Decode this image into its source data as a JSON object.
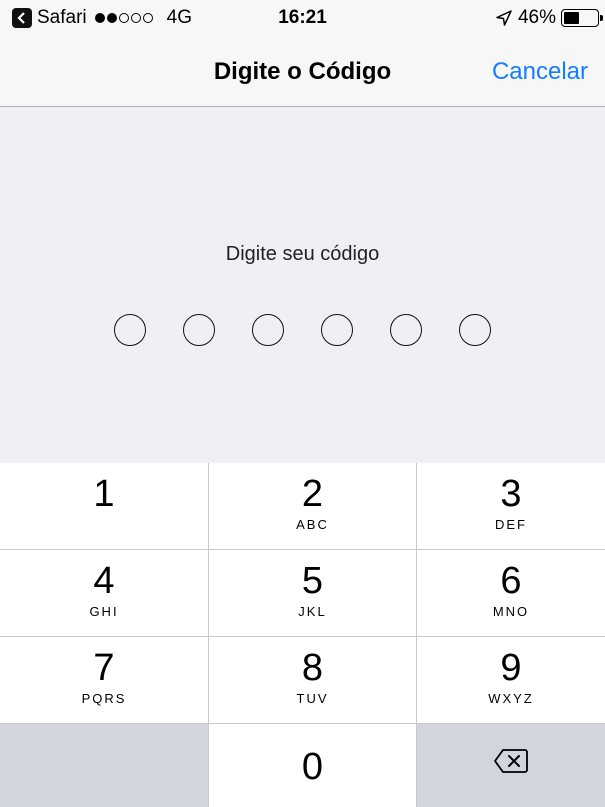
{
  "status_bar": {
    "app": "Safari",
    "carrier": "4G",
    "time": "16:21",
    "battery": "46%",
    "battery_level": 0.46,
    "signal_strength": 2,
    "signal_max": 5
  },
  "nav": {
    "title": "Digite o Código",
    "cancel_label": "Cancelar"
  },
  "passcode": {
    "prompt": "Digite seu código",
    "length": 6,
    "entered": 0
  },
  "keypad": {
    "keys": [
      {
        "num": "1",
        "letters": ""
      },
      {
        "num": "2",
        "letters": "ABC"
      },
      {
        "num": "3",
        "letters": "DEF"
      },
      {
        "num": "4",
        "letters": "GHI"
      },
      {
        "num": "5",
        "letters": "JKL"
      },
      {
        "num": "6",
        "letters": "MNO"
      },
      {
        "num": "7",
        "letters": "PQRS"
      },
      {
        "num": "8",
        "letters": "TUV"
      },
      {
        "num": "9",
        "letters": "WXYZ"
      },
      {
        "num": "0",
        "letters": ""
      }
    ],
    "delete_icon": "backspace-icon"
  },
  "colors": {
    "accent": "#147efb",
    "background": "#efeff4",
    "keypad_gray": "#d2d5db"
  }
}
